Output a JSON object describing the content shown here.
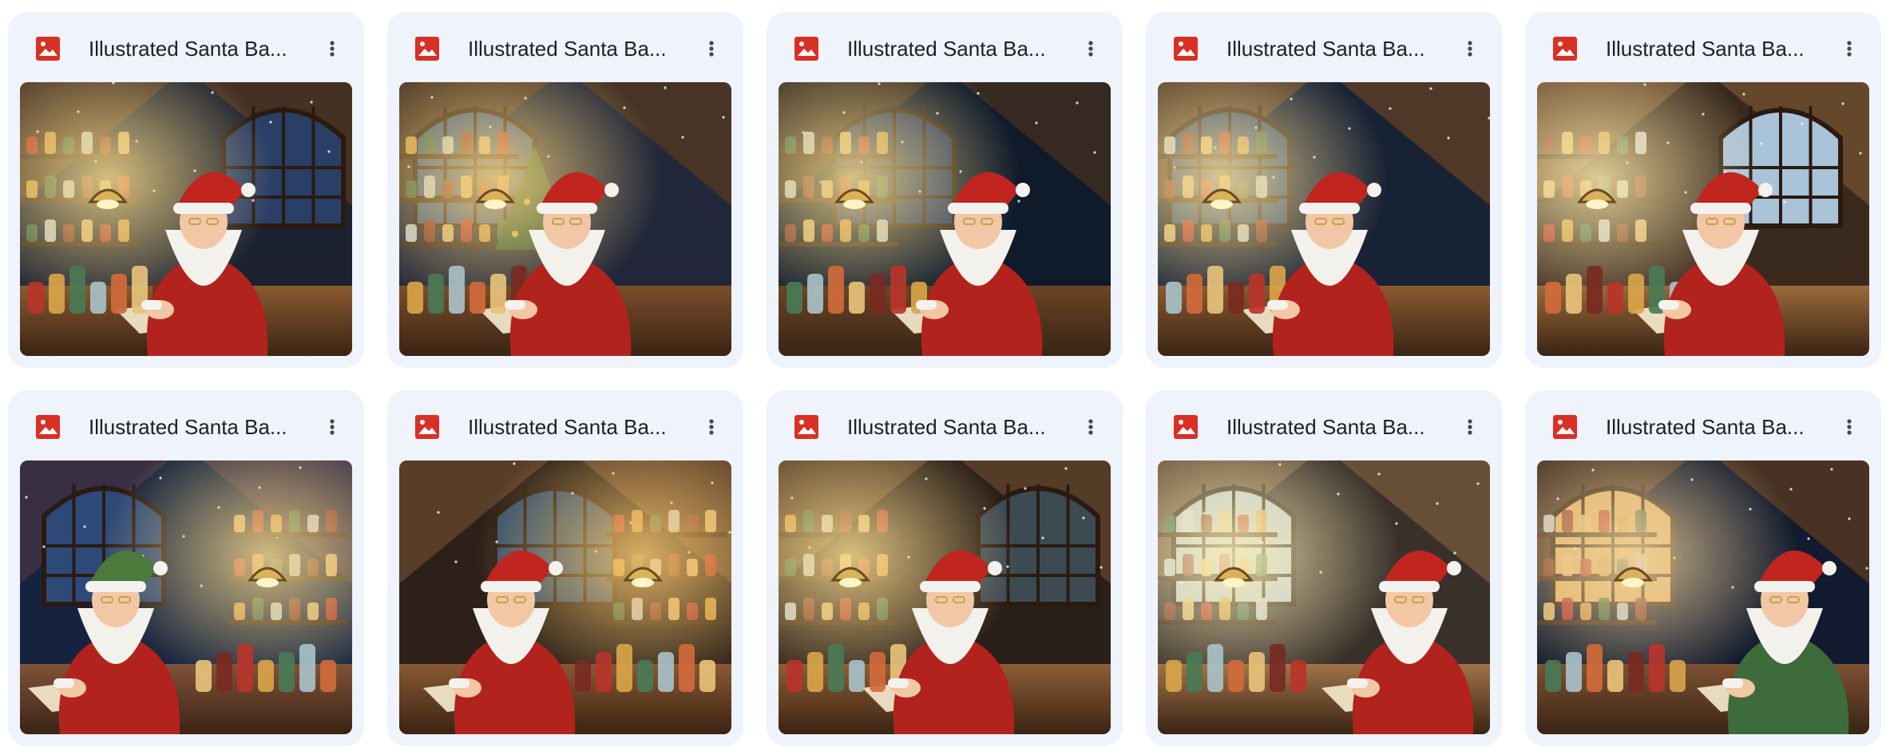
{
  "files": [
    {
      "name": "Illustrated Santa Ba...",
      "icon": "image-file-icon",
      "menu_icon": "more-vert-icon",
      "thumbnail": {
        "subject": "santa-workshop-illustration",
        "variant": 1
      }
    },
    {
      "name": "Illustrated Santa Ba...",
      "icon": "image-file-icon",
      "menu_icon": "more-vert-icon",
      "thumbnail": {
        "subject": "santa-workshop-illustration",
        "variant": 2
      }
    },
    {
      "name": "Illustrated Santa Ba...",
      "icon": "image-file-icon",
      "menu_icon": "more-vert-icon",
      "thumbnail": {
        "subject": "santa-workshop-illustration",
        "variant": 3
      }
    },
    {
      "name": "Illustrated Santa Ba...",
      "icon": "image-file-icon",
      "menu_icon": "more-vert-icon",
      "thumbnail": {
        "subject": "santa-workshop-illustration",
        "variant": 4
      }
    },
    {
      "name": "Illustrated Santa Ba...",
      "icon": "image-file-icon",
      "menu_icon": "more-vert-icon",
      "thumbnail": {
        "subject": "santa-workshop-illustration",
        "variant": 5
      }
    },
    {
      "name": "Illustrated Santa Ba...",
      "icon": "image-file-icon",
      "menu_icon": "more-vert-icon",
      "thumbnail": {
        "subject": "santa-workshop-illustration",
        "variant": 6
      }
    },
    {
      "name": "Illustrated Santa Ba...",
      "icon": "image-file-icon",
      "menu_icon": "more-vert-icon",
      "thumbnail": {
        "subject": "santa-workshop-illustration",
        "variant": 7
      }
    },
    {
      "name": "Illustrated Santa Ba...",
      "icon": "image-file-icon",
      "menu_icon": "more-vert-icon",
      "thumbnail": {
        "subject": "santa-workshop-illustration",
        "variant": 8
      }
    },
    {
      "name": "Illustrated Santa Ba...",
      "icon": "image-file-icon",
      "menu_icon": "more-vert-icon",
      "thumbnail": {
        "subject": "santa-workshop-illustration",
        "variant": 9
      }
    },
    {
      "name": "Illustrated Santa Ba...",
      "icon": "image-file-icon",
      "menu_icon": "more-vert-icon",
      "thumbnail": {
        "subject": "santa-workshop-illustration",
        "variant": 10
      }
    }
  ],
  "colors": {
    "card_bg": "#eef3fc",
    "image_icon_red": "#d93025",
    "text": "#1f1f1f",
    "menu_dots": "#444746"
  }
}
